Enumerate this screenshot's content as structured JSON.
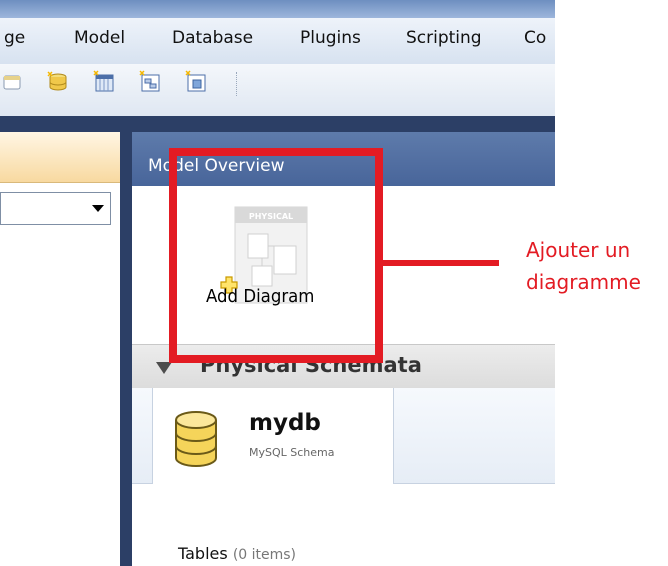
{
  "menu": {
    "items": [
      "ge",
      "Model",
      "Database",
      "Plugins",
      "Scripting",
      "Co"
    ]
  },
  "toolbar": {
    "icons": [
      "open-model-icon",
      "add-schema-icon",
      "add-table-icon",
      "add-view-icon",
      "add-routine-icon"
    ]
  },
  "model_overview": {
    "title": "Model Overview",
    "add_diagram_label": "Add Diagram",
    "diagram_thumbnail_text": "PHYSICAL"
  },
  "physical_schemata": {
    "title": "Physical Schemata",
    "schema": {
      "name": "mydb",
      "type": "MySQL Schema"
    }
  },
  "tables": {
    "label": "Tables",
    "count": "(0 items)"
  },
  "annotation": {
    "text": "Ajouter un\ndiagramme",
    "color": "#e31b23"
  },
  "colors": {
    "workspace": "#2c3f66",
    "overview_header": "#5e7bab",
    "annotation_red": "#e31b23"
  }
}
